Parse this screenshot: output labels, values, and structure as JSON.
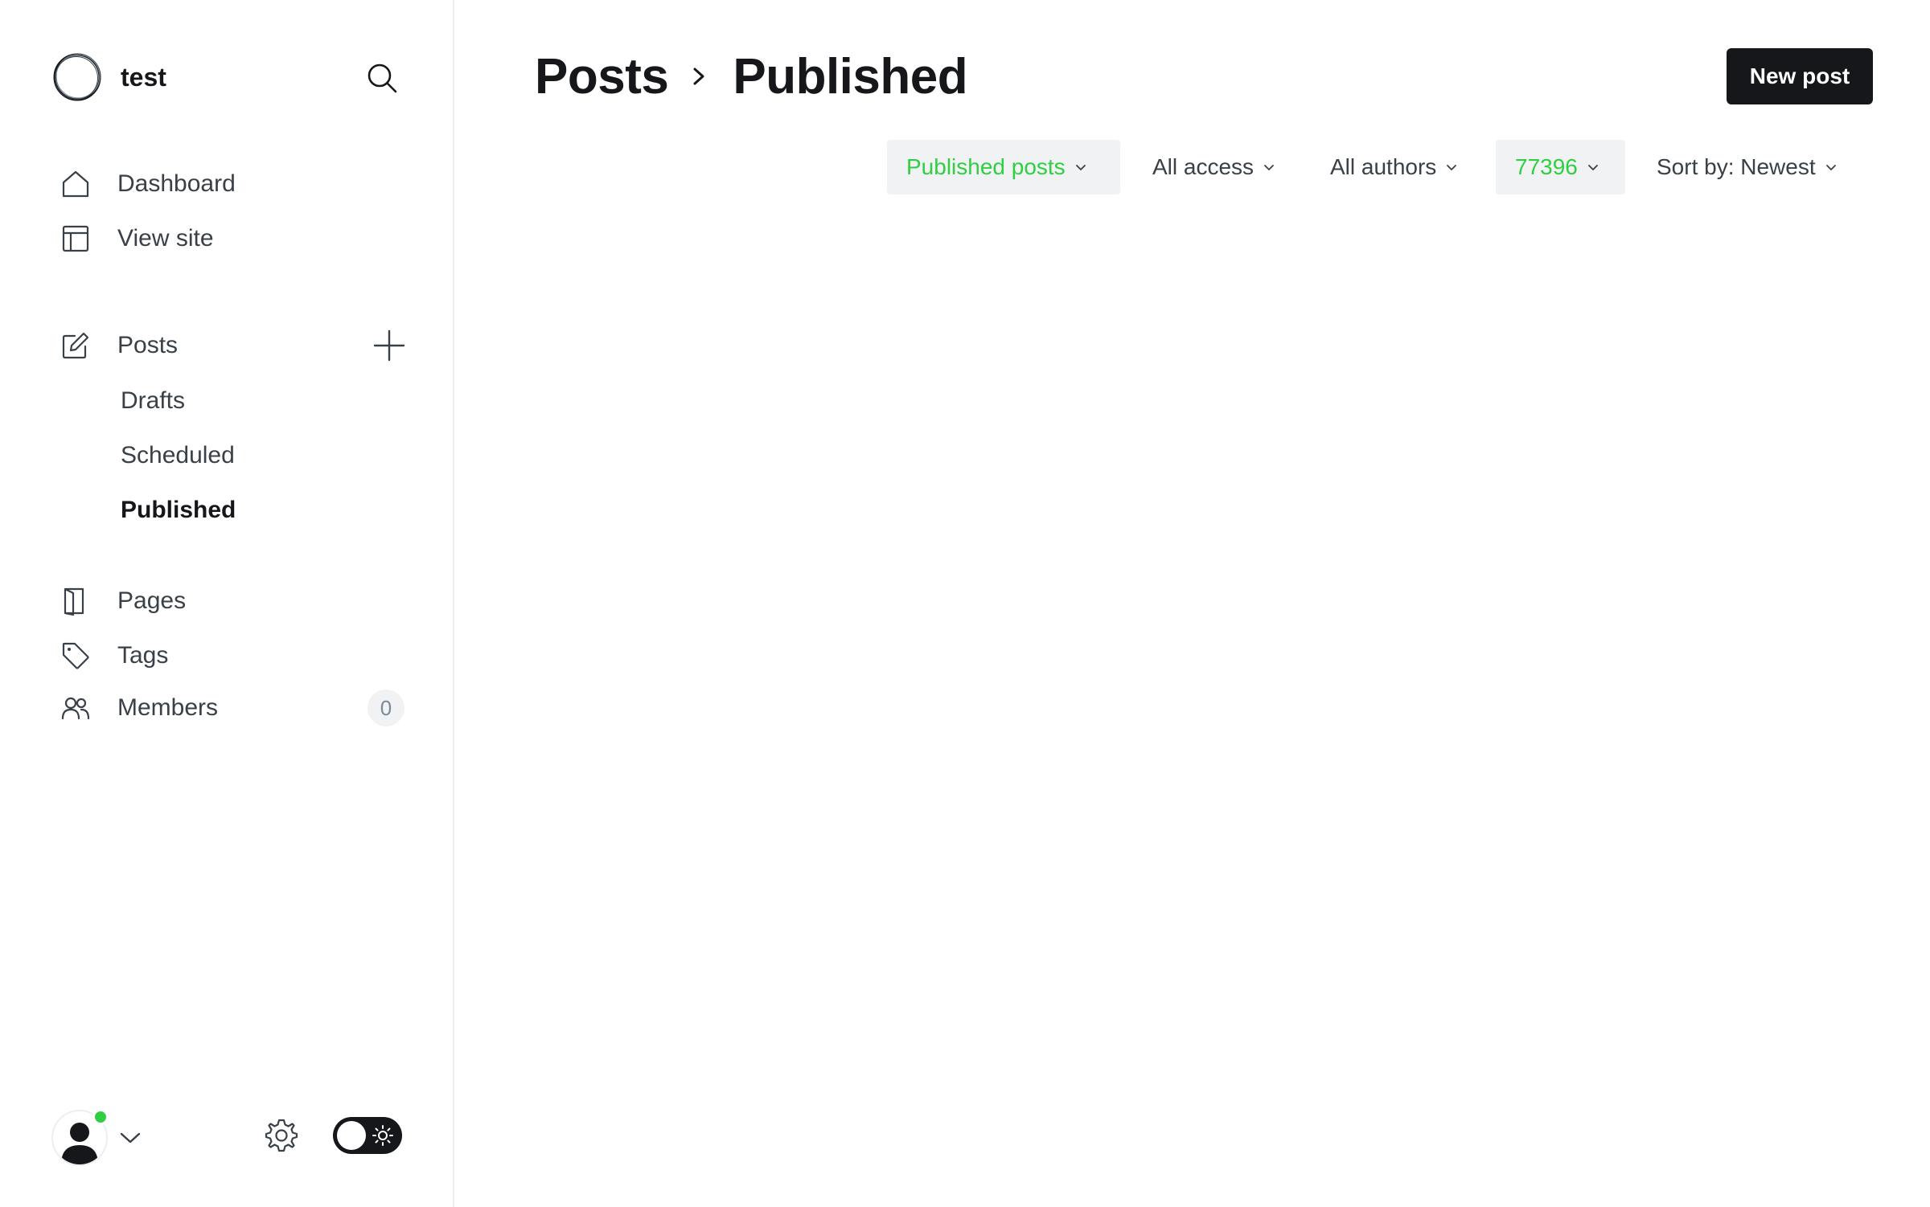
{
  "site": {
    "name": "test"
  },
  "sidebar": {
    "primary": [
      {
        "label": "Dashboard",
        "icon": "home-icon"
      },
      {
        "label": "View site",
        "icon": "layout-icon"
      }
    ],
    "posts": {
      "label": "Posts",
      "icon": "edit-icon",
      "sub_items": [
        {
          "label": "Drafts"
        },
        {
          "label": "Scheduled"
        },
        {
          "label": "Published",
          "active": true
        }
      ]
    },
    "secondary": [
      {
        "label": "Pages",
        "icon": "page-icon"
      },
      {
        "label": "Tags",
        "icon": "tag-icon"
      },
      {
        "label": "Members",
        "icon": "members-icon",
        "count": "0"
      }
    ]
  },
  "header": {
    "breadcrumb_root": "Posts",
    "breadcrumb_current": "Published",
    "new_post_label": "New post"
  },
  "filters": [
    {
      "label": "Published posts",
      "active": true
    },
    {
      "label": "All access",
      "active": false
    },
    {
      "label": "All authors",
      "active": false
    },
    {
      "label": "77396",
      "active": true
    },
    {
      "label": "Sort by: Newest",
      "active": false
    }
  ],
  "colors": {
    "accent_green": "#30cf43",
    "text_dark": "#15171a",
    "text_mid": "#394047",
    "chip_bg": "#f1f2f3"
  }
}
